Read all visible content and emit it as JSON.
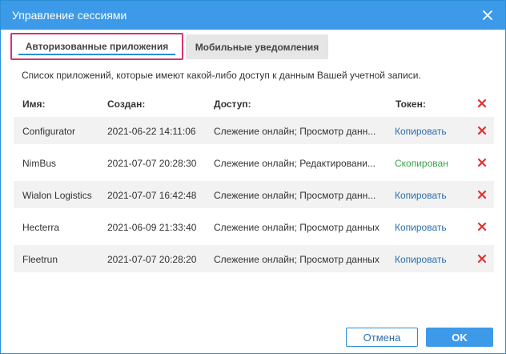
{
  "dialog": {
    "title": "Управление сессиями",
    "accent_color": "#3d9ae8",
    "close_icon": "close-icon"
  },
  "tabs": [
    {
      "label": "Авторизованные приложения",
      "active": true
    },
    {
      "label": "Мобильные уведомления",
      "active": false
    }
  ],
  "description": "Список приложений, которые имеют какой-либо доступ к данным Вашей учетной записи.",
  "table": {
    "headers": {
      "name": "Имя:",
      "created": "Создан:",
      "access": "Доступ:",
      "token": "Токен:"
    },
    "rows": [
      {
        "name": "Configurator",
        "created": "2021-06-22 14:11:06",
        "access": "Слежение онлайн; Просмотр данн...",
        "token": "Копировать"
      },
      {
        "name": "NimBus",
        "created": "2021-07-07 20:28:30",
        "access": "Слежение онлайн; Редактировани...",
        "token": "Скопирован"
      },
      {
        "name": "Wialon Logistics",
        "created": "2021-07-07 16:42:48",
        "access": "Слежение онлайн; Просмотр данн...",
        "token": "Копировать"
      },
      {
        "name": "Hecterra",
        "created": "2021-06-09 21:33:40",
        "access": "Слежение онлайн; Просмотр данных",
        "token": "Копировать"
      },
      {
        "name": "Fleetrun",
        "created": "2021-07-07 20:28:20",
        "access": "Слежение онлайн; Просмотр данных",
        "token": "Копировать"
      }
    ]
  },
  "footer": {
    "cancel_label": "Отмена",
    "ok_label": "OK"
  },
  "colors": {
    "delete": "#e03131",
    "link": "#2a6eb0",
    "copied": "#3aa14a",
    "active_tab_border": "#d9336e"
  }
}
